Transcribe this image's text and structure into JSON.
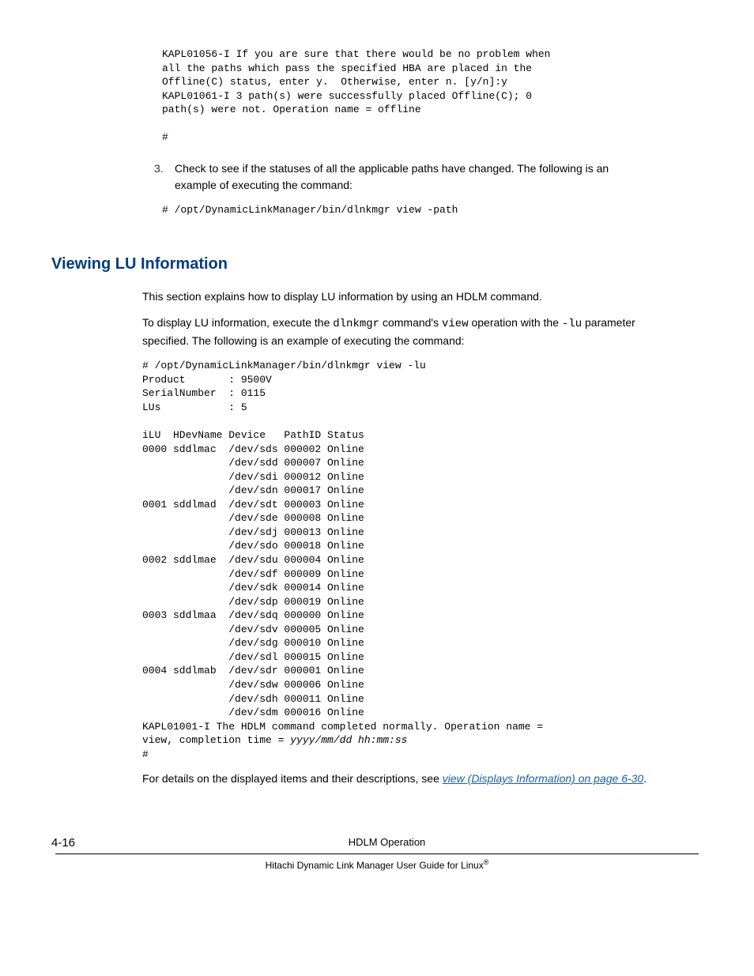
{
  "code_block_1": "KAPL01056-I If you are sure that there would be no problem when\nall the paths which pass the specified HBA are placed in the\nOffline(C) status, enter y.  Otherwise, enter n. [y/n]:y\nKAPL01061-I 3 path(s) were successfully placed Offline(C); 0\npath(s) were not. Operation name = offline\n\n#",
  "list": {
    "num": "3.",
    "text": "Check to see if the statuses of all the applicable paths have changed. The following is an example of executing the command:"
  },
  "code_block_2": "# /opt/DynamicLinkManager/bin/dlnkmgr view -path",
  "heading": "Viewing LU Information",
  "para_1": "This section explains how to display LU information by using an HDLM command.",
  "para_2_a": "To display LU information, execute the ",
  "para_2_cmd1": "dlnkmgr",
  "para_2_b": " command's ",
  "para_2_cmd2": "view",
  "para_2_c": " operation with the ",
  "para_2_cmd3": "-lu",
  "para_2_d": " parameter specified. The following is an example of executing the command:",
  "chart_data": {
    "type": "table",
    "command": "# /opt/DynamicLinkManager/bin/dlnkmgr view -lu",
    "header": {
      "Product": "9500V",
      "SerialNumber": "0115",
      "LUs": "5"
    },
    "columns": [
      "iLU",
      "HDevName",
      "Device",
      "PathID",
      "Status"
    ],
    "rows": [
      {
        "iLU": "0000",
        "HDevName": "sddlmac",
        "Device": "/dev/sds",
        "PathID": "000002",
        "Status": "Online"
      },
      {
        "iLU": "",
        "HDevName": "",
        "Device": "/dev/sdd",
        "PathID": "000007",
        "Status": "Online"
      },
      {
        "iLU": "",
        "HDevName": "",
        "Device": "/dev/sdi",
        "PathID": "000012",
        "Status": "Online"
      },
      {
        "iLU": "",
        "HDevName": "",
        "Device": "/dev/sdn",
        "PathID": "000017",
        "Status": "Online"
      },
      {
        "iLU": "0001",
        "HDevName": "sddlmad",
        "Device": "/dev/sdt",
        "PathID": "000003",
        "Status": "Online"
      },
      {
        "iLU": "",
        "HDevName": "",
        "Device": "/dev/sde",
        "PathID": "000008",
        "Status": "Online"
      },
      {
        "iLU": "",
        "HDevName": "",
        "Device": "/dev/sdj",
        "PathID": "000013",
        "Status": "Online"
      },
      {
        "iLU": "",
        "HDevName": "",
        "Device": "/dev/sdo",
        "PathID": "000018",
        "Status": "Online"
      },
      {
        "iLU": "0002",
        "HDevName": "sddlmae",
        "Device": "/dev/sdu",
        "PathID": "000004",
        "Status": "Online"
      },
      {
        "iLU": "",
        "HDevName": "",
        "Device": "/dev/sdf",
        "PathID": "000009",
        "Status": "Online"
      },
      {
        "iLU": "",
        "HDevName": "",
        "Device": "/dev/sdk",
        "PathID": "000014",
        "Status": "Online"
      },
      {
        "iLU": "",
        "HDevName": "",
        "Device": "/dev/sdp",
        "PathID": "000019",
        "Status": "Online"
      },
      {
        "iLU": "0003",
        "HDevName": "sddlmaa",
        "Device": "/dev/sdq",
        "PathID": "000000",
        "Status": "Online"
      },
      {
        "iLU": "",
        "HDevName": "",
        "Device": "/dev/sdv",
        "PathID": "000005",
        "Status": "Online"
      },
      {
        "iLU": "",
        "HDevName": "",
        "Device": "/dev/sdg",
        "PathID": "000010",
        "Status": "Online"
      },
      {
        "iLU": "",
        "HDevName": "",
        "Device": "/dev/sdl",
        "PathID": "000015",
        "Status": "Online"
      },
      {
        "iLU": "0004",
        "HDevName": "sddlmab",
        "Device": "/dev/sdr",
        "PathID": "000001",
        "Status": "Online"
      },
      {
        "iLU": "",
        "HDevName": "",
        "Device": "/dev/sdw",
        "PathID": "000006",
        "Status": "Online"
      },
      {
        "iLU": "",
        "HDevName": "",
        "Device": "/dev/sdh",
        "PathID": "000011",
        "Status": "Online"
      },
      {
        "iLU": "",
        "HDevName": "",
        "Device": "/dev/sdm",
        "PathID": "000016",
        "Status": "Online"
      }
    ],
    "trailer_a": "KAPL01001-I The HDLM command completed normally. Operation name =\nview, completion time = ",
    "trailer_time": "yyyy/mm/dd hh:mm:ss",
    "trailer_b": "\n#"
  },
  "para_3_a": "For details on the displayed items and their descriptions, see ",
  "para_3_link": "view (Displays Information) on page 6-30",
  "para_3_b": ".",
  "footer": {
    "page": "4-16",
    "title": "HDLM Operation",
    "subtitle_a": "Hitachi Dynamic Link Manager User Guide for Linux",
    "subtitle_sup": "®"
  }
}
